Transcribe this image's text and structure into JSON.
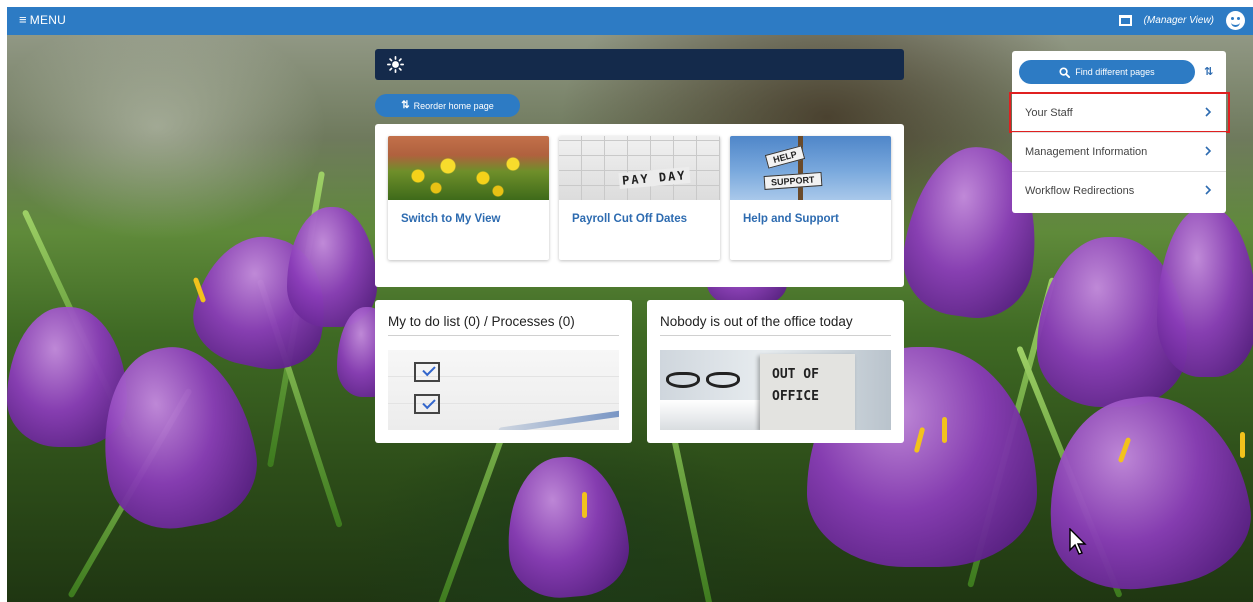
{
  "topbar": {
    "menu_label": "MENU",
    "view_label": "(Manager View)"
  },
  "reorder_button": {
    "label": "Reorder home page"
  },
  "tiles": [
    {
      "label": "Switch to My View"
    },
    {
      "label": "Payroll Cut Off Dates",
      "image_text": "PAY DAY"
    },
    {
      "label": "Help and Support",
      "image_text": [
        "HELP",
        "SUPPORT"
      ]
    }
  ],
  "widgets": {
    "todo": {
      "title": "My to do list (0) / Processes (0)"
    },
    "out_of_office": {
      "title": "Nobody is out of the office today",
      "image_text": [
        "OUT OF",
        "OFFICE"
      ]
    }
  },
  "right_panel": {
    "find_button": "Find different pages",
    "items": [
      {
        "label": "Your Staff",
        "highlighted": true
      },
      {
        "label": "Management Information"
      },
      {
        "label": "Workflow Redirections"
      }
    ]
  },
  "colors": {
    "brand_blue": "#2d7bc4",
    "dark_navy": "#142a4b",
    "link_blue": "#2d6bb0",
    "highlight_red": "#e02020"
  },
  "icons": {
    "menu": "hamburger-icon",
    "window": "window-icon",
    "profile": "avatar-icon",
    "weather": "sun-icon",
    "reorder": "sort-icon",
    "search": "search-icon",
    "nav_arrow": "chevron-right-icon"
  }
}
